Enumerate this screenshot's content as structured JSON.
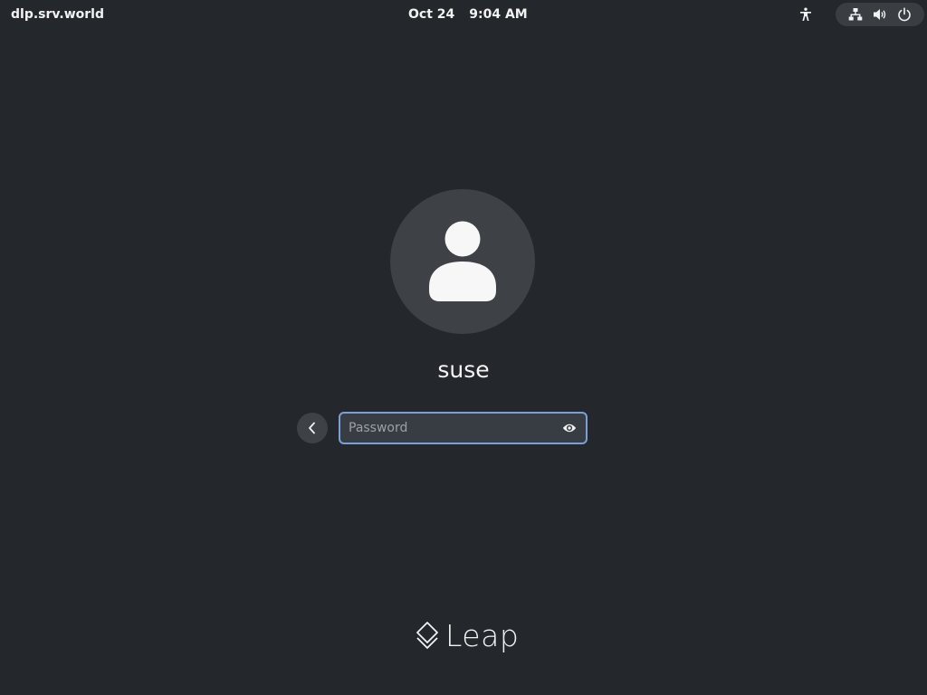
{
  "topbar": {
    "hostname": "dlp.srv.world",
    "date": "Oct 24",
    "time": "9:04 AM"
  },
  "icons": {
    "accessibility": "accessibility-icon",
    "network": "network-wired-icon",
    "volume": "volume-icon",
    "power": "power-icon",
    "avatar": "user-avatar-icon",
    "back": "chevron-left-icon",
    "reveal": "eye-icon",
    "logo": "leap-logo-icon"
  },
  "login": {
    "username": "suse",
    "password_placeholder": "Password",
    "password_value": ""
  },
  "brand": {
    "name": "Leap"
  },
  "colors": {
    "background": "#24272b",
    "accent_focus": "#7b9fd8",
    "surface": "#3e4146"
  }
}
